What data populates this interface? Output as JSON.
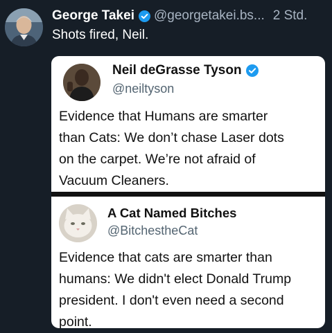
{
  "post": {
    "display_name": "George Takei",
    "handle": "@georgetakei.bs...",
    "time": "2 Std.",
    "text": "Shots fired, Neil.",
    "avatar_icon": "person-avatar-icon",
    "verified_color": "#1d9bf0"
  },
  "embedded_image": {
    "tweet1": {
      "name": "Neil deGrasse Tyson",
      "handle": "@neiltyson",
      "verified": true,
      "lines": [
        "Evidence that Humans are smarter",
        "than Cats:  We don’t chase Laser dots",
        "on the carpet. We’re not afraid of",
        "Vacuum Cleaners."
      ]
    },
    "tweet2": {
      "name": "A Cat Named Bitches",
      "handle": "@BitchestheCat",
      "lines": [
        "Evidence that cats are smarter than",
        "humans: We didn't elect Donald Trump",
        "president. I don't even need a second",
        "point."
      ]
    }
  }
}
